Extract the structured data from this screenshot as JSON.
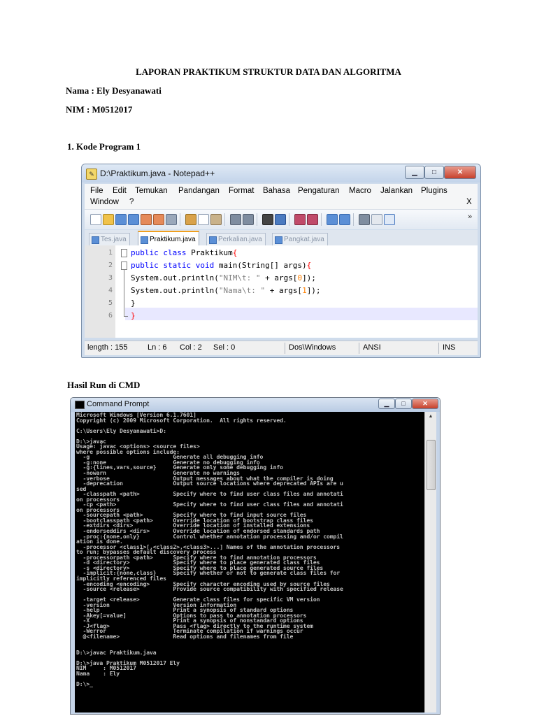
{
  "report": {
    "title": "LAPORAN PRAKTIKUM STRUKTUR DATA DAN ALGORITMA",
    "name_label": "Nama  : Ely Desyanawati",
    "nim_label": "NIM    : M0512017",
    "section1": "1.   Kode Program 1",
    "section2": "Hasil Run di CMD"
  },
  "notepad": {
    "title": "D:\\Praktikum.java - Notepad++",
    "menu": [
      "File",
      "Edit",
      "Temukan",
      "Pandangan",
      "Format",
      "Bahasa",
      "Pengaturan",
      "Macro",
      "Jalankan",
      "Plugins"
    ],
    "menu_row2": [
      "Window",
      "?"
    ],
    "menu_close": "X",
    "toolbar_more": "»",
    "tabs": [
      "Tes.java",
      "Praktikum.java",
      "Perkalian.java",
      "Pangkat.java"
    ],
    "active_tab": 1,
    "line_numbers": [
      "1",
      "2",
      "3",
      "4",
      "5",
      "6"
    ],
    "code": {
      "l1_kw": "public class",
      "l1_rest": " Praktikum",
      "l1_brace": "{",
      "l2_kw": "public static void",
      "l2_rest": " main(String[] args)",
      "l2_brace": "{",
      "l3_a": "System.out.println(",
      "l3_str": "\"NIM\\t: \"",
      "l3_b": " + args[",
      "l3_num": "0",
      "l3_c": "]);",
      "l4_a": "System.out.println(",
      "l4_str": "\"Nama\\t: \"",
      "l4_b": " + args[",
      "l4_num": "1",
      "l4_c": "]);",
      "l5": "}",
      "l6": "}"
    },
    "status": {
      "length": "length : 155",
      "ln": "Ln : 6",
      "col": "Col : 2",
      "sel": "Sel : 0",
      "eol": "Dos\\Windows",
      "encoding": "ANSI",
      "mode": "INS"
    },
    "colors": {
      "keyword": "#0000ff",
      "brace": "#ff0000",
      "string": "#808080",
      "number": "#ff8000"
    }
  },
  "cmd": {
    "title": "Command Prompt",
    "output": "Microsoft Windows [Version 6.1.7601]\nCopyright (c) 2009 Microsoft Corporation.  All rights reserved.\n\nC:\\Users\\Ely Desyanawati>D:\n\nD:\\>javac\nUsage: javac <options> <source files>\nwhere possible options include:\n  -g                         Generate all debugging info\n  -g:none                    Generate no debugging info\n  -g:{lines,vars,source}     Generate only some debugging info\n  -nowarn                    Generate no warnings\n  -verbose                   Output messages about what the compiler is doing\n  -deprecation               Output source locations where deprecated APIs are u\nsed\n  -classpath <path>          Specify where to find user class files and annotati\non processors\n  -cp <path>                 Specify where to find user class files and annotati\non processors\n  -sourcepath <path>         Specify where to find input source files\n  -bootclasspath <path>      Override location of bootstrap class files\n  -extdirs <dirs>            Override location of installed extensions\n  -endorseddirs <dirs>       Override location of endorsed standards path\n  -proc:{none,only}          Control whether annotation processing and/or compil\nation is done.\n  -processor <class1>[,<class2>,<class3>...] Names of the annotation processors\nto run; bypasses default discovery process\n  -processorpath <path>      Specify where to find annotation processors\n  -d <directory>             Specify where to place generated class files\n  -s <directory>             Specify where to place generated source files\n  -implicit:{none,class}     Specify whether or not to generate class files for\nimplicitly referenced files\n  -encoding <encoding>       Specify character encoding used by source files\n  -source <release>          Provide source compatibility with specified release\n\n  -target <release>          Generate class files for specific VM version\n  -version                   Version information\n  -help                      Print a synopsis of standard options\n  -Akey[=value]              Options to pass to annotation processors\n  -X                         Print a synopsis of nonstandard options\n  -J<flag>                   Pass <flag> directly to the runtime system\n  -Werror                    Terminate compilation if warnings occur\n  @<filename>                Read options and filenames from file\n\n\nD:\\>javac Praktikum.java\n\nD:\\>java Praktikum M0512017 Ely\nNIM     : M0512017\nNama    : Ely\n\nD:\\>_"
  }
}
